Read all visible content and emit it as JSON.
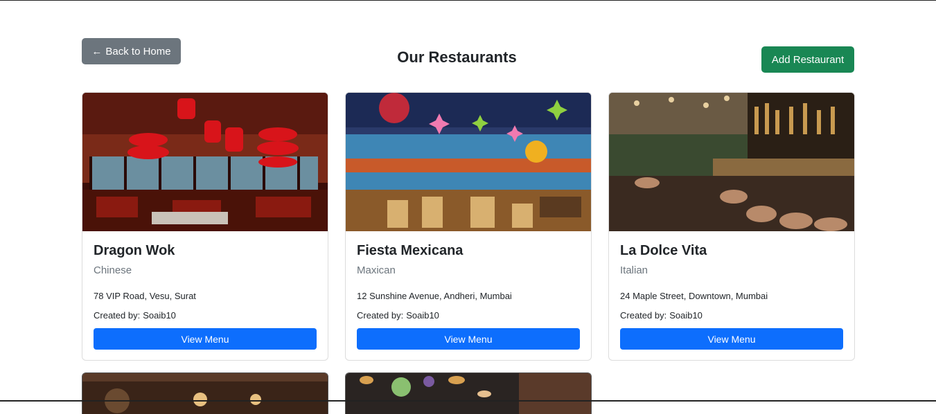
{
  "header": {
    "back_label": "Back to Home",
    "back_arrow": "←",
    "title": "Our Restaurants",
    "add_label": "Add Restaurant"
  },
  "restaurants": [
    {
      "name": "Dragon Wok",
      "cuisine": "Chinese",
      "address": "78 VIP Road, Vesu, Surat",
      "created_by_label": "Created by:",
      "created_by": "Soaib10",
      "button": "View Menu",
      "image": "chinese-restaurant-interior-photo"
    },
    {
      "name": "Fiesta Mexicana",
      "cuisine": "Maxican",
      "address": "12 Sunshine Avenue, Andheri, Mumbai",
      "created_by_label": "Created by:",
      "created_by": "Soaib10",
      "button": "View Menu",
      "image": "mexican-restaurant-interior-photo"
    },
    {
      "name": "La Dolce Vita",
      "cuisine": "Italian",
      "address": "24 Maple Street, Downtown, Mumbai",
      "created_by_label": "Created by:",
      "created_by": "Soaib10",
      "button": "View Menu",
      "image": "italian-restaurant-bar-photo"
    }
  ],
  "colors": {
    "secondary": "#6c757d",
    "success": "#198754",
    "primary": "#0d6efd"
  }
}
